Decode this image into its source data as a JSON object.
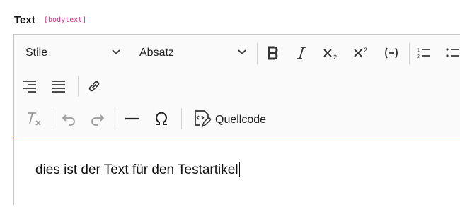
{
  "field": {
    "label": "Text",
    "code": "[bodytext]"
  },
  "toolbar": {
    "style_dropdown": "Stile",
    "format_dropdown": "Absatz",
    "source_button_label": "Quellcode"
  },
  "icons": [
    "bold-icon",
    "italic-icon",
    "subscript-icon",
    "superscript-icon",
    "strikeout-icon",
    "numbered-list-icon",
    "bulleted-list-icon",
    "align-right-icon",
    "justify-icon",
    "link-icon",
    "remove-format-icon",
    "undo-icon",
    "redo-icon",
    "horizontal-line-icon",
    "special-char-icon",
    "source-code-icon"
  ],
  "editor": {
    "content": "dies ist der Text für den Testartikel"
  },
  "colors": {
    "focus_border": "#2f6fd6",
    "code_text": "#d63384"
  }
}
